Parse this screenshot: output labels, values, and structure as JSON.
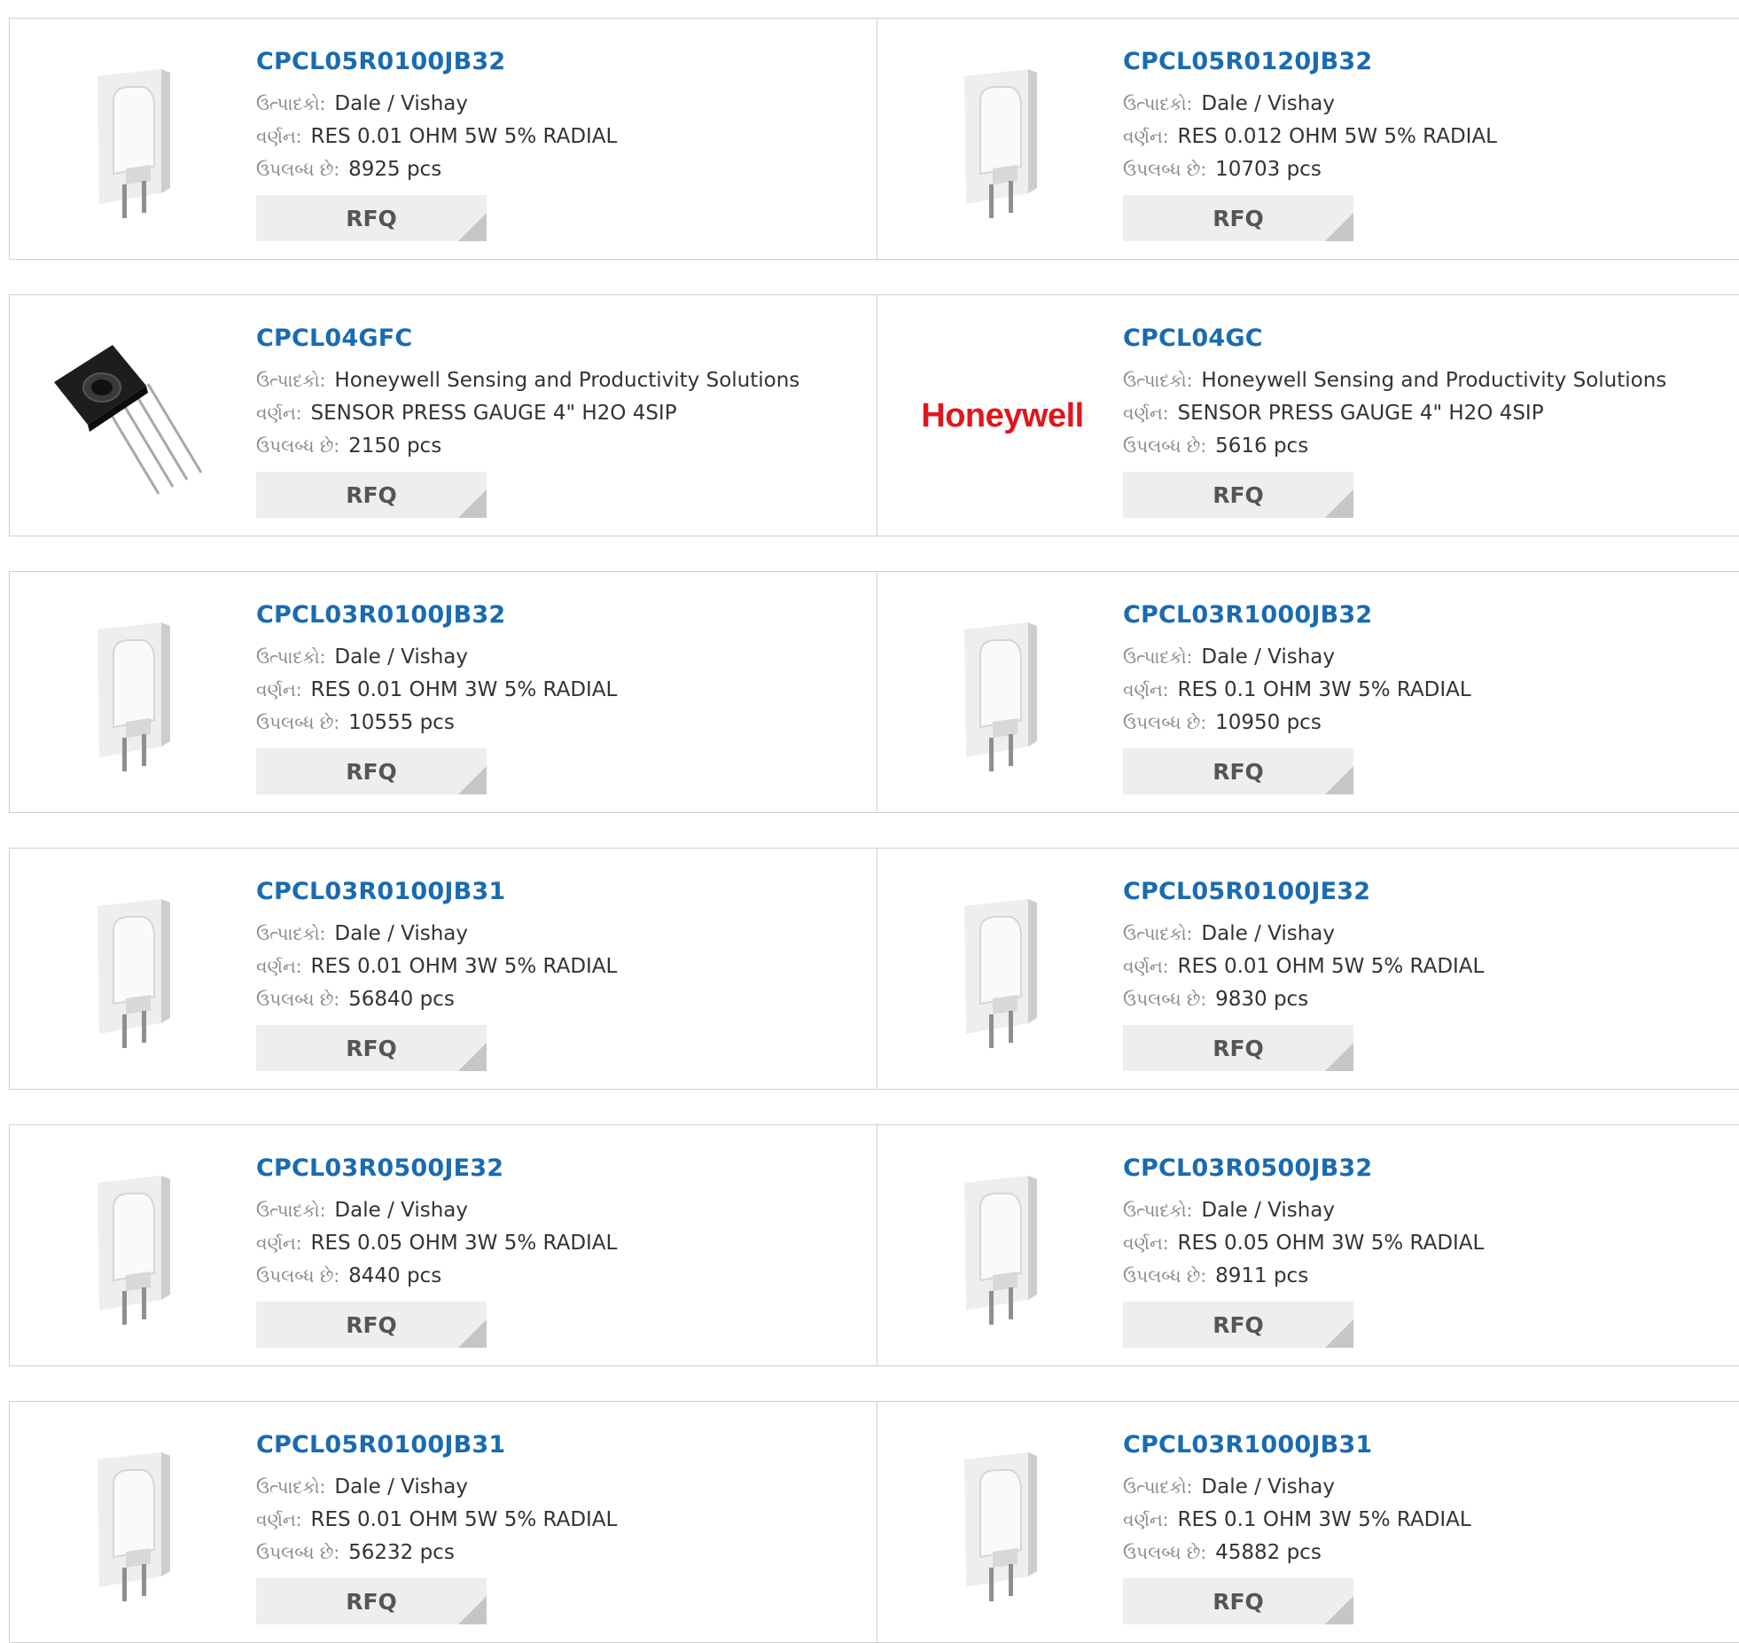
{
  "labels": {
    "manufacturer": "ઉત્પાદકો:",
    "description": "વર્ણન:",
    "available": "ઉપલબ્ધ છે:",
    "rfq": "RFQ"
  },
  "products": [
    {
      "part": "CPCL05R0100JB32",
      "manufacturer": "Dale / Vishay",
      "description": "RES 0.01 OHM 5W 5% RADIAL",
      "stock": "8925 pcs",
      "image": "resistor-image"
    },
    {
      "part": "CPCL05R0120JB32",
      "manufacturer": "Dale / Vishay",
      "description": "RES 0.012 OHM 5W 5% RADIAL",
      "stock": "10703 pcs",
      "image": "resistor-image"
    },
    {
      "part": "CPCL04GFC",
      "manufacturer": "Honeywell Sensing and Productivity Solutions",
      "description": "SENSOR PRESS GAUGE 4\" H2O 4SIP",
      "stock": "2150 pcs",
      "image": "sensor-image"
    },
    {
      "part": "CPCL04GC",
      "manufacturer": "Honeywell Sensing and Productivity Solutions",
      "description": "SENSOR PRESS GAUGE 4\" H2O 4SIP",
      "stock": "5616 pcs",
      "image": "honeywell-logo",
      "logo_text": "Honeywell"
    },
    {
      "part": "CPCL03R0100JB32",
      "manufacturer": "Dale / Vishay",
      "description": "RES 0.01 OHM 3W 5% RADIAL",
      "stock": "10555 pcs",
      "image": "resistor-image"
    },
    {
      "part": "CPCL03R1000JB32",
      "manufacturer": "Dale / Vishay",
      "description": "RES 0.1 OHM 3W 5% RADIAL",
      "stock": "10950 pcs",
      "image": "resistor-image"
    },
    {
      "part": "CPCL03R0100JB31",
      "manufacturer": "Dale / Vishay",
      "description": "RES 0.01 OHM 3W 5% RADIAL",
      "stock": "56840 pcs",
      "image": "resistor-image"
    },
    {
      "part": "CPCL05R0100JE32",
      "manufacturer": "Dale / Vishay",
      "description": "RES 0.01 OHM 5W 5% RADIAL",
      "stock": "9830 pcs",
      "image": "resistor-image"
    },
    {
      "part": "CPCL03R0500JE32",
      "manufacturer": "Dale / Vishay",
      "description": "RES 0.05 OHM 3W 5% RADIAL",
      "stock": "8440 pcs",
      "image": "resistor-image"
    },
    {
      "part": "CPCL03R0500JB32",
      "manufacturer": "Dale / Vishay",
      "description": "RES 0.05 OHM 3W 5% RADIAL",
      "stock": "8911 pcs",
      "image": "resistor-image"
    },
    {
      "part": "CPCL05R0100JB31",
      "manufacturer": "Dale / Vishay",
      "description": "RES 0.01 OHM 5W 5% RADIAL",
      "stock": "56232 pcs",
      "image": "resistor-image"
    },
    {
      "part": "CPCL03R1000JB31",
      "manufacturer": "Dale / Vishay",
      "description": "RES 0.1 OHM 3W 5% RADIAL",
      "stock": "45882 pcs",
      "image": "resistor-image"
    }
  ],
  "colors": {
    "link": "#1a6bb0",
    "label": "#8a8a8a",
    "border": "#cfcfcf",
    "button_bg": "#eeeeee",
    "brand_red": "#e0161c"
  }
}
